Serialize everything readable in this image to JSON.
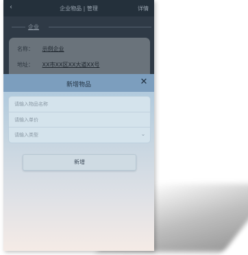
{
  "background_page": {
    "back_icon": "chevron-left-icon",
    "title": "企业物品 | 管理",
    "action_label": "详情",
    "section_label": "企业",
    "card": {
      "rows": [
        {
          "key": "名称：",
          "value": "示例企业"
        },
        {
          "key": "地址：",
          "value": "XX市XX区XX大道XX号"
        }
      ]
    }
  },
  "modal": {
    "title": "新增物品",
    "close_icon": "close-icon",
    "fields": [
      {
        "placeholder": "请输入物品名称",
        "value": ""
      },
      {
        "placeholder": "请输入单价",
        "value": ""
      },
      {
        "placeholder": "请输入类型",
        "value": "",
        "icon": "chevron-down-icon"
      }
    ],
    "submit_label": "新增"
  },
  "colors": {
    "modal_header": "#7c9ebe",
    "modal_gradient_top": "#a9c6dc",
    "modal_gradient_bottom": "#f5ebe6",
    "dim_overlay": "#2f3a46"
  }
}
